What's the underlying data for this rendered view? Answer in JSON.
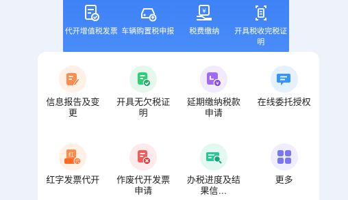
{
  "top_services": [
    {
      "label": "代开增值税发票",
      "icon": "invoice-check-icon"
    },
    {
      "label": "车辆购置税申报",
      "icon": "car-tax-icon"
    },
    {
      "label": "税费缴纳",
      "icon": "tax-payment-icon"
    },
    {
      "label": "开具税收完税证明",
      "icon": "tax-certificate-icon"
    }
  ],
  "services": [
    {
      "label": "信息报告及变更",
      "icon": "edit-report-icon",
      "color": "#ff7a3c",
      "bg": "#fff1e6"
    },
    {
      "label": "开具无欠税证明",
      "icon": "no-debt-certificate-icon",
      "color": "#22c36b",
      "bg": "#e6f8ee"
    },
    {
      "label": "延期缴纳税款申请",
      "icon": "deferred-payment-icon",
      "color": "#9b5cf6",
      "bg": "#f2ebfe"
    },
    {
      "label": "在线委托授权",
      "icon": "online-authorize-icon",
      "color": "#2f8cf5",
      "bg": "#e6f1fe"
    },
    {
      "label": "红字发票代开",
      "icon": "red-invoice-icon",
      "color": "#ff7a3c",
      "bg": "#fff1e6"
    },
    {
      "label": "作废代开发票申请",
      "icon": "void-invoice-icon",
      "color": "#f0484a",
      "bg": "#fdeaea"
    },
    {
      "label": "办税进度及结果信…",
      "icon": "progress-search-icon",
      "color": "#1fbf8c",
      "bg": "#e3f8f0"
    },
    {
      "label": "更多",
      "icon": "more-grid-icon",
      "color": "#6f6cf0",
      "bg": "#eeeeff"
    }
  ]
}
